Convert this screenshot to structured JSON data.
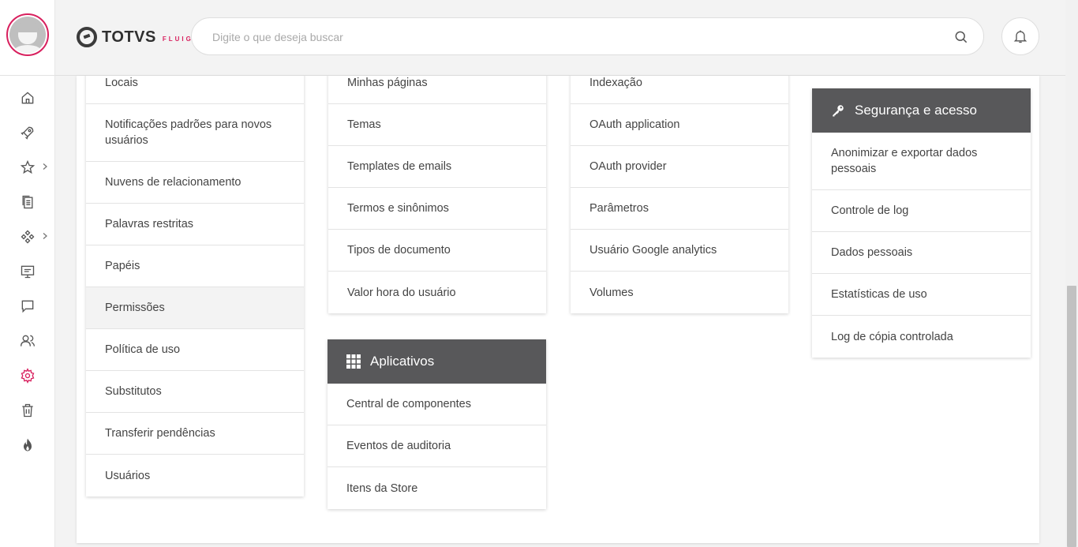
{
  "header": {
    "logo_text": "TOTVS",
    "logo_sub": "FLUIG",
    "search_placeholder": "Digite o que deseja buscar"
  },
  "sidebar": {
    "items": [
      {
        "icon": "home-icon"
      },
      {
        "icon": "rocket-icon"
      },
      {
        "icon": "star-icon",
        "has_submenu": true
      },
      {
        "icon": "documents-icon"
      },
      {
        "icon": "workflow-icon",
        "has_submenu": true
      },
      {
        "icon": "presentation-icon"
      },
      {
        "icon": "chat-icon"
      },
      {
        "icon": "users-icon"
      },
      {
        "icon": "gear-icon",
        "active": true
      },
      {
        "icon": "trash-icon"
      },
      {
        "icon": "flame-icon"
      }
    ],
    "active_color": "#d8205e"
  },
  "columns": {
    "col1": {
      "items": [
        "Locais",
        "Notificações padrões para novos usuários",
        "Nuvens de relacionamento",
        "Palavras restritas",
        "Papéis",
        "Permissões",
        "Política de uso",
        "Substitutos",
        "Transferir pendências",
        "Usuários"
      ],
      "active_index": 5
    },
    "col2": {
      "items": [
        "Minhas páginas",
        "Temas",
        "Templates de emails",
        "Termos e sinônimos",
        "Tipos de documento",
        "Valor hora do usuário"
      ]
    },
    "apps": {
      "title": "Aplicativos",
      "icon": "grid-icon",
      "items": [
        "Central de componentes",
        "Eventos de auditoria",
        "Itens da Store"
      ]
    },
    "col3": {
      "items": [
        "Indexação",
        "OAuth application",
        "OAuth provider",
        "Parâmetros",
        "Usuário Google analytics",
        "Volumes"
      ]
    },
    "security": {
      "title": "Segurança e acesso",
      "icon": "key-icon",
      "items": [
        "Anonimizar e exportar dados pessoais",
        "Controle de log",
        "Dados pessoais",
        "Estatísticas de uso",
        "Log de cópia controlada"
      ]
    }
  },
  "colors": {
    "card_header_bg": "#58585a",
    "accent": "#d8205e"
  }
}
